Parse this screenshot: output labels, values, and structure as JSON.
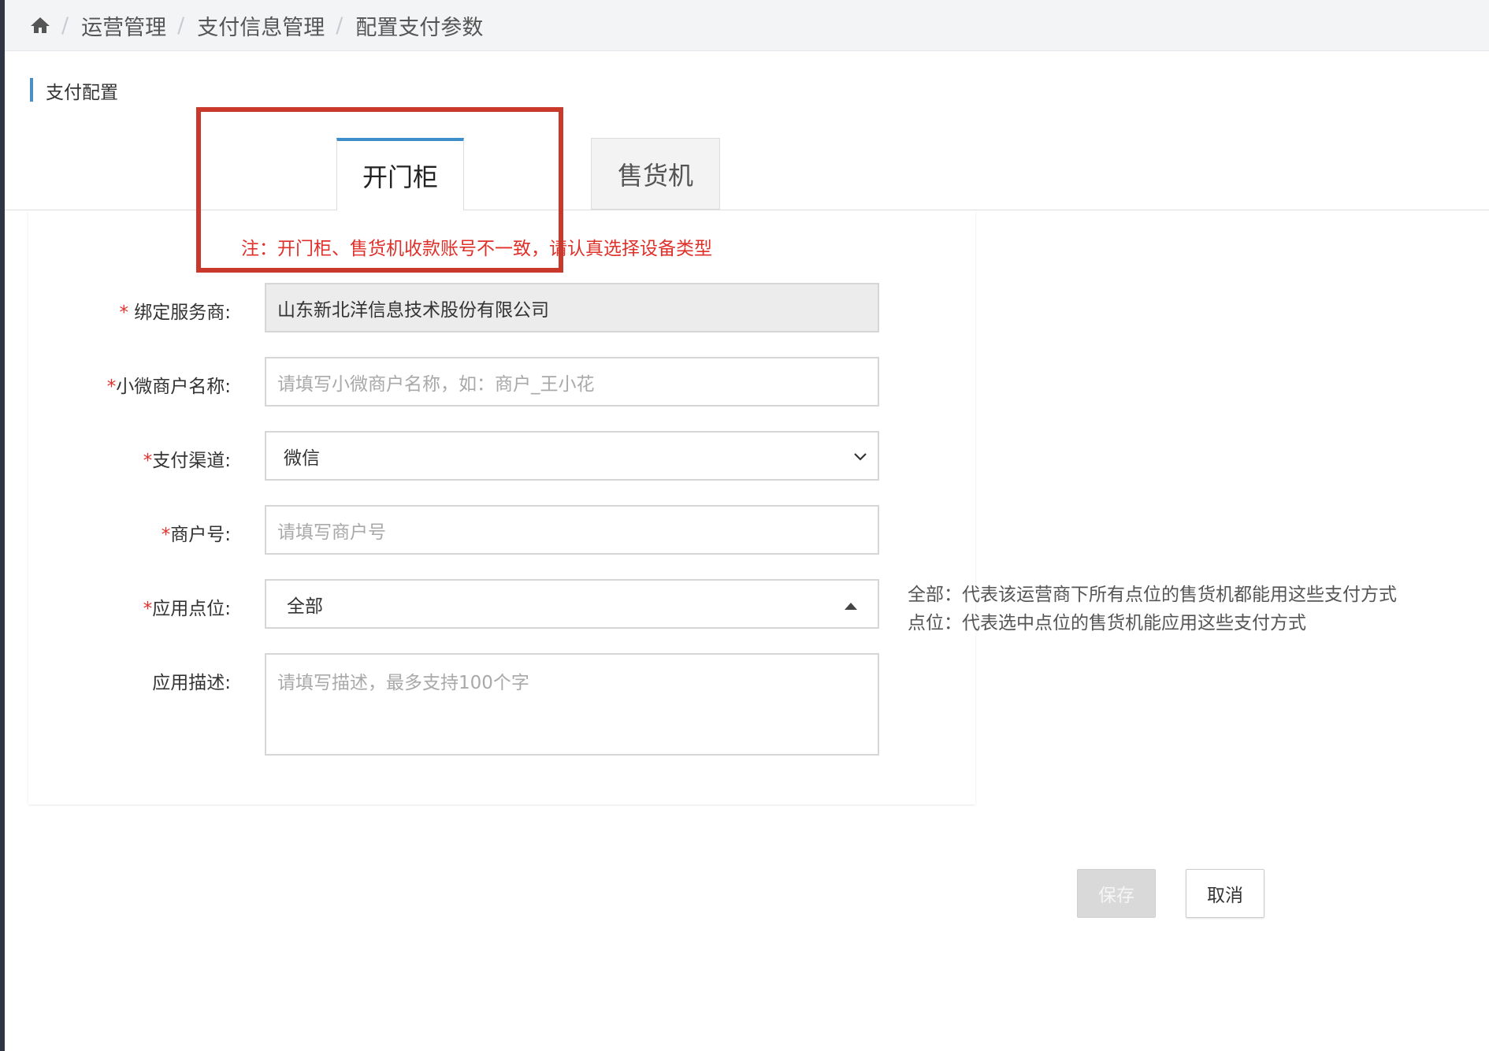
{
  "breadcrumb": {
    "home_icon": "home-icon",
    "items": [
      "运营管理",
      "支付信息管理",
      "配置支付参数"
    ]
  },
  "section": {
    "title": "支付配置"
  },
  "tabs": [
    {
      "label": "开门柜",
      "active": true
    },
    {
      "label": "售货机",
      "active": false
    }
  ],
  "note": "注：开门柜、售货机收款账号不一致，请认真选择设备类型",
  "form": {
    "service_provider": {
      "label": "绑定服务商:",
      "value": "山东新北洋信息技术股份有限公司"
    },
    "merchant_name": {
      "label": "小微商户名称:",
      "placeholder": "请填写小微商户名称，如：商户_王小花"
    },
    "pay_channel": {
      "label": "支付渠道:",
      "value": "微信"
    },
    "merchant_no": {
      "label": "商户号:",
      "placeholder": "请填写商户号"
    },
    "apply_point": {
      "label": "应用点位:",
      "value": "全部",
      "hints": [
        "全部：代表该运营商下所有点位的售货机都能用这些支付方式",
        "点位：代表选中点位的售货机能应用这些支付方式"
      ]
    },
    "description": {
      "label": "应用描述:",
      "placeholder": "请填写描述，最多支持100个字"
    }
  },
  "buttons": {
    "save": "保存",
    "cancel": "取消"
  },
  "colors": {
    "accent": "#3d8ec9",
    "required": "#e0302a",
    "highlight_box": "#c8392b"
  }
}
